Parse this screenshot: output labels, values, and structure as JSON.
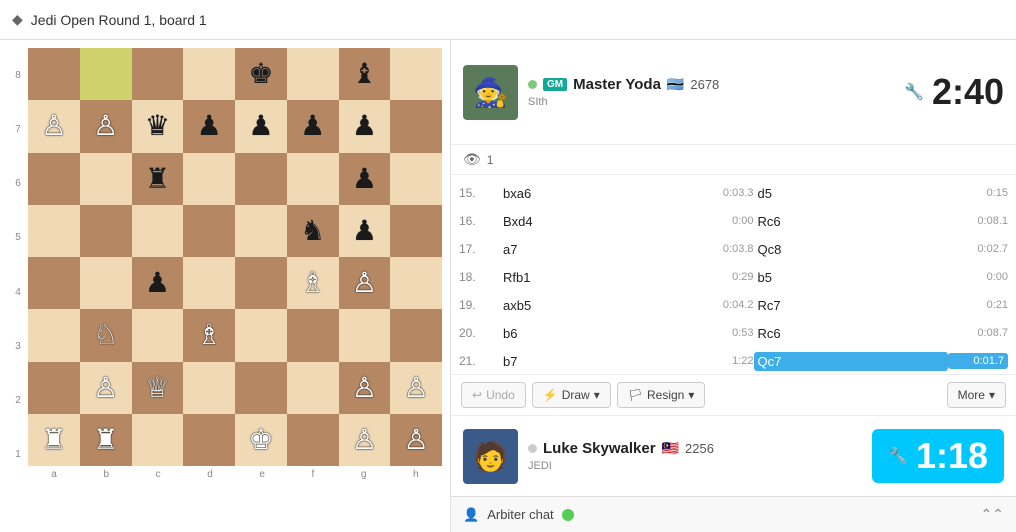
{
  "title": {
    "icon": "◆",
    "text": "Jedi Open Round 1, board 1"
  },
  "top_player": {
    "online": true,
    "gm_label": "GM",
    "name": "Master Yoda",
    "flag": "🇧🇼",
    "rating": "2678",
    "title_sub": "SIth",
    "clock": "2:40",
    "clock_icon": "🔧"
  },
  "watchers": {
    "icon": "👁",
    "count": "1"
  },
  "moves": [
    {
      "num": "15.",
      "white": "bxa6",
      "wtime": "0:03.3",
      "black": "d5",
      "btime": "0:15"
    },
    {
      "num": "16.",
      "white": "Bxd4",
      "wtime": "0:00",
      "black": "Rc6",
      "btime": "0:08.1"
    },
    {
      "num": "17.",
      "white": "a7",
      "wtime": "0:03.8",
      "black": "Qc8",
      "btime": "0:02.7"
    },
    {
      "num": "18.",
      "white": "Rfb1",
      "wtime": "0:29",
      "black": "b5",
      "btime": "0:00"
    },
    {
      "num": "19.",
      "white": "axb5",
      "wtime": "0:04.2",
      "black": "Rc7",
      "btime": "0:21"
    },
    {
      "num": "20.",
      "white": "b6",
      "wtime": "0:53",
      "black": "Rc6",
      "btime": "0:08.7"
    },
    {
      "num": "21.",
      "white": "b7",
      "wtime": "1:22",
      "black": "Qc7",
      "btime": "0:01.7",
      "black_active": true
    }
  ],
  "buttons": {
    "undo": "Undo",
    "draw": "Draw",
    "draw_icon": "⚡",
    "resign": "Resign",
    "resign_icon": "🏳",
    "more": "More"
  },
  "bottom_player": {
    "online": false,
    "name": "Luke Skywalker",
    "flag": "🇲🇾",
    "rating": "2256",
    "title_sub": "JEDI",
    "clock": "1:18"
  },
  "arbiter": {
    "icon": "👤",
    "label": "Arbiter chat",
    "has_notification": true
  },
  "board": {
    "ranks": [
      "8",
      "7",
      "6",
      "5",
      "4",
      "3",
      "2",
      "1"
    ],
    "files": [
      "a",
      "b",
      "c",
      "d",
      "e",
      "f",
      "g",
      "h"
    ]
  }
}
